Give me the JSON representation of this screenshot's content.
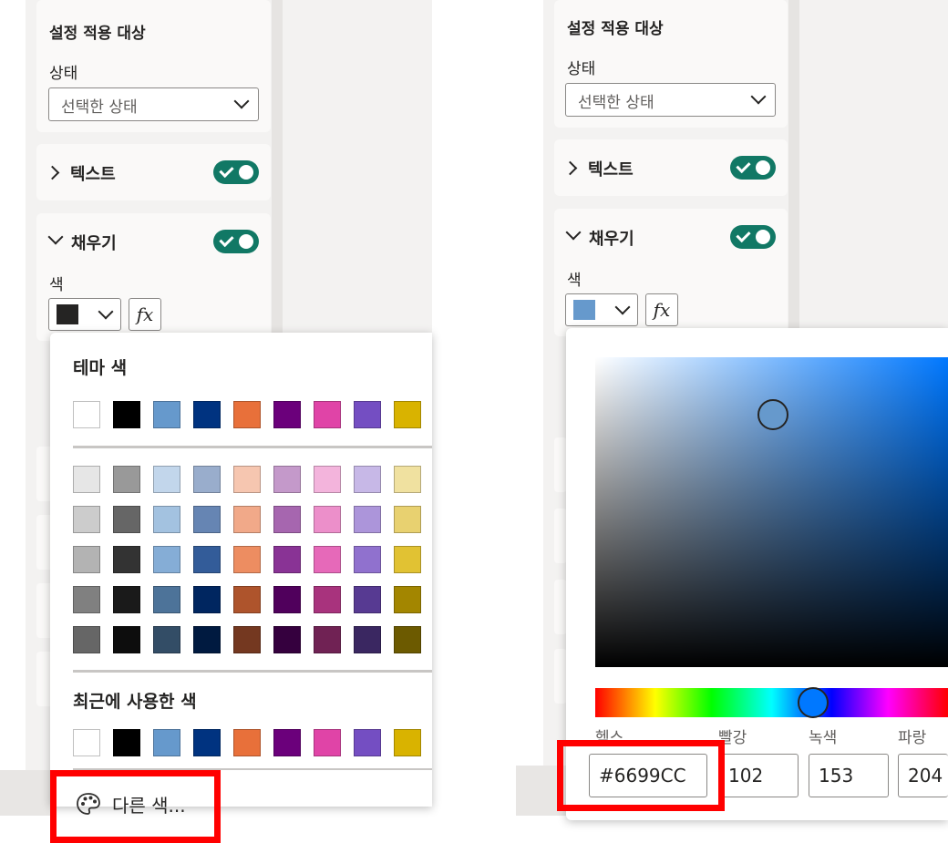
{
  "left": {
    "apply_section_title": "설정 적용 대상",
    "state_label": "상태",
    "state_value": "선택한 상태",
    "text_section": "텍스트",
    "fill_section": "채우기",
    "color_label": "색",
    "fx_label": "fx",
    "current_color": "#252423",
    "theme_title": "테마 색",
    "theme_colors": [
      "#FFFFFF",
      "#000000",
      "#6699CC",
      "#003380",
      "#E8703A",
      "#6B007B",
      "#E044A7",
      "#744EC2",
      "#D9B300"
    ],
    "shades": [
      [
        "#E6E6E6",
        "#999999",
        "#C2D6EB",
        "#99ADCC",
        "#F6C6B0",
        "#C499CA",
        "#F3B4DC",
        "#C7B8E7",
        "#F0E1A0"
      ],
      [
        "#CCCCCC",
        "#666666",
        "#A3C2E0",
        "#6685B3",
        "#F1A989",
        "#A666AF",
        "#EC8FCA",
        "#AC95DA",
        "#E8D170"
      ],
      [
        "#B3B3B3",
        "#333333",
        "#85ADD6",
        "#335C99",
        "#ED8D61",
        "#893395",
        "#E669B9",
        "#9071CE",
        "#E1C233"
      ],
      [
        "#808080",
        "#1A1A1A",
        "#4D7399",
        "#002660",
        "#AE542C",
        "#50005C",
        "#A8337D",
        "#573A92",
        "#A38600"
      ],
      [
        "#666666",
        "#0D0D0D",
        "#334D66",
        "#001A40",
        "#743820",
        "#35003E",
        "#702254",
        "#3A2761",
        "#6C5A00"
      ]
    ],
    "recent_title": "최근에 사용한 색",
    "recent_colors": [
      "#FFFFFF",
      "#000000",
      "#6699CC",
      "#003380",
      "#E8703A",
      "#6B007B",
      "#E044A7",
      "#744EC2",
      "#D9B300"
    ],
    "more_colors_label": "다른 색..."
  },
  "right": {
    "apply_section_title": "설정 적용 대상",
    "state_label": "상태",
    "state_value": "선택한 상태",
    "text_section": "텍스트",
    "fill_section": "채우기",
    "color_label": "색",
    "fx_label": "fx",
    "current_color": "#6699CC",
    "hex_label": "헥스",
    "red_label": "빨강",
    "green_label": "녹색",
    "blue_label": "파랑",
    "hex_value": "#6699CC",
    "red_value": "102",
    "green_value": "153",
    "blue_value": "204"
  },
  "colors": {
    "toggle": "#117865",
    "highlight": "#FF0000"
  }
}
